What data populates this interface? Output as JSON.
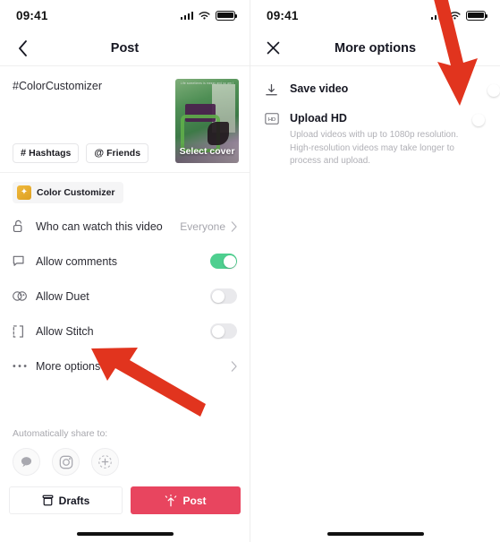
{
  "left_phone": {
    "status_bar": {
      "time": "09:41",
      "signal_icon": "signal-bars-icon",
      "wifi_icon": "wifi-icon",
      "battery_icon": "battery-icon"
    },
    "nav": {
      "back_icon": "chevron-left-icon",
      "title": "Post"
    },
    "caption": {
      "text": "#ColorCustomizer"
    },
    "chips": [
      {
        "symbol": "#",
        "label": "Hashtags",
        "icon": "hashtag-icon"
      },
      {
        "symbol": "@",
        "label": "Friends",
        "icon": "at-mention-icon"
      }
    ],
    "cover": {
      "overlay_label": "Select cover",
      "top_text": "Life sometimes is messy and so am I"
    },
    "badge": {
      "label": "Color Customizer",
      "icon": "sparkle-wand-icon",
      "color": "#e8a92b"
    },
    "settings": [
      {
        "label": "Who can watch this video",
        "icon": "unlock-icon",
        "value": "Everyone",
        "control": "chevron"
      },
      {
        "label": "Allow comments",
        "icon": "comment-bubble-icon",
        "control": "toggle",
        "on": true
      },
      {
        "label": "Allow Duet",
        "icon": "duet-icon",
        "control": "toggle",
        "on": false
      },
      {
        "label": "Allow Stitch",
        "icon": "stitch-icon",
        "control": "toggle",
        "on": false
      },
      {
        "label": "More options",
        "icon": "ellipsis-icon",
        "control": "chevron"
      }
    ],
    "share": {
      "title": "Automatically share to:",
      "targets": [
        {
          "name": "messages-share-icon"
        },
        {
          "name": "instagram-share-icon"
        },
        {
          "name": "add-more-share-icon"
        }
      ]
    },
    "buttons": {
      "drafts": {
        "label": "Drafts",
        "icon": "drafts-box-icon"
      },
      "post": {
        "label": "Post",
        "icon": "post-arrow-icon",
        "color": "#e8455f"
      }
    }
  },
  "right_phone": {
    "status_bar": {
      "time": "09:41",
      "signal_icon": "signal-bars-icon",
      "wifi_icon": "wifi-icon",
      "battery_icon": "battery-icon"
    },
    "nav": {
      "close_icon": "close-x-icon",
      "title": "More options"
    },
    "options": [
      {
        "label": "Save video",
        "icon": "download-icon",
        "description": "",
        "on": false
      },
      {
        "label": "Upload HD",
        "icon": "hd-icon",
        "description": "Upload videos with up to 1080p resolution. High-resolution videos may take longer to process and upload.",
        "on": true
      }
    ]
  },
  "annotations": {
    "arrow_color": "#e1341e",
    "arrows": [
      {
        "name": "arrow-to-more-options",
        "target": "More options"
      },
      {
        "name": "arrow-to-upload-hd-toggle",
        "target": "Upload HD toggle"
      }
    ]
  },
  "colors": {
    "accent_red": "#e8455f",
    "toggle_green": "#4ecf8f",
    "arrow_red": "#e1341e"
  }
}
